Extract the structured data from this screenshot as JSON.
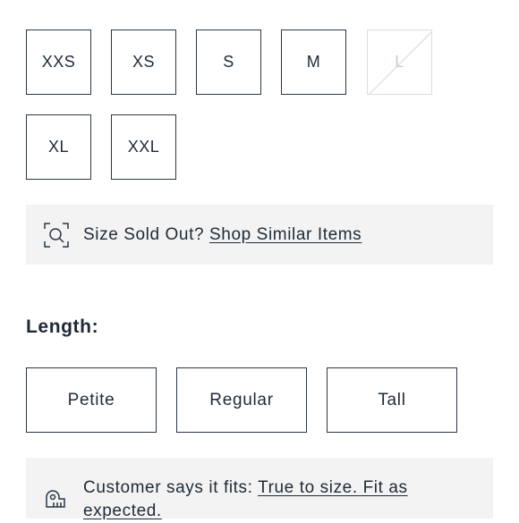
{
  "sizes": [
    {
      "label": "XXS",
      "available": true
    },
    {
      "label": "XS",
      "available": true
    },
    {
      "label": "S",
      "available": true
    },
    {
      "label": "M",
      "available": true
    },
    {
      "label": "L",
      "available": false
    },
    {
      "label": "XL",
      "available": true
    },
    {
      "label": "XXL",
      "available": true
    }
  ],
  "sold_out": {
    "text": "Size Sold Out?",
    "link": "Shop Similar Items",
    "icon": "visual-search-icon"
  },
  "length": {
    "label": "Length:",
    "options": [
      "Petite",
      "Regular",
      "Tall"
    ]
  },
  "fit": {
    "text": "Customer says it fits:",
    "link_line1": "True to size. Fit as",
    "link_line2": "expected.",
    "icon": "tape-measure-icon"
  },
  "colors": {
    "border": "#2b3744",
    "text": "#1f2a36",
    "disabled": "#c4ccd4",
    "panel_bg": "#f3f3f3"
  }
}
